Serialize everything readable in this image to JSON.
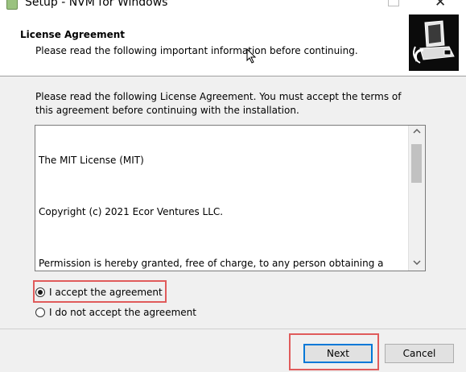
{
  "window": {
    "title": "Setup - NVM for Windows",
    "close_glyph": "✕"
  },
  "header": {
    "title": "License Agreement",
    "subtitle": "Please read the following important information before continuing.",
    "icon": "installer-computer-icon"
  },
  "instructions": "Please read the following License Agreement. You must accept the terms of this agreement before continuing with the installation.",
  "license": {
    "paragraphs": [
      "The MIT License (MIT)",
      "Copyright (c) 2021 Ecor Ventures LLC.",
      "Permission is hereby granted, free of charge, to any person obtaining a copy\nof this Software and associated documentation files (the \"Software\"), to deal\nin the Software without restriction, including without limitation the rights\nto use, copy, modify, merge, publish, distribute, sublicense, and/or sell\ncopies of the Software, and to permit persons to whom the Software is\nfurnished to do so, subject to the following conditions:"
    ]
  },
  "options": {
    "accept_label": "I accept the agreement",
    "decline_label": "I do not accept the agreement",
    "selected": "accept"
  },
  "buttons": {
    "next": "Next",
    "cancel": "Cancel"
  },
  "colors": {
    "highlight": "#e05b5b",
    "default_button_border": "#0078d7"
  }
}
